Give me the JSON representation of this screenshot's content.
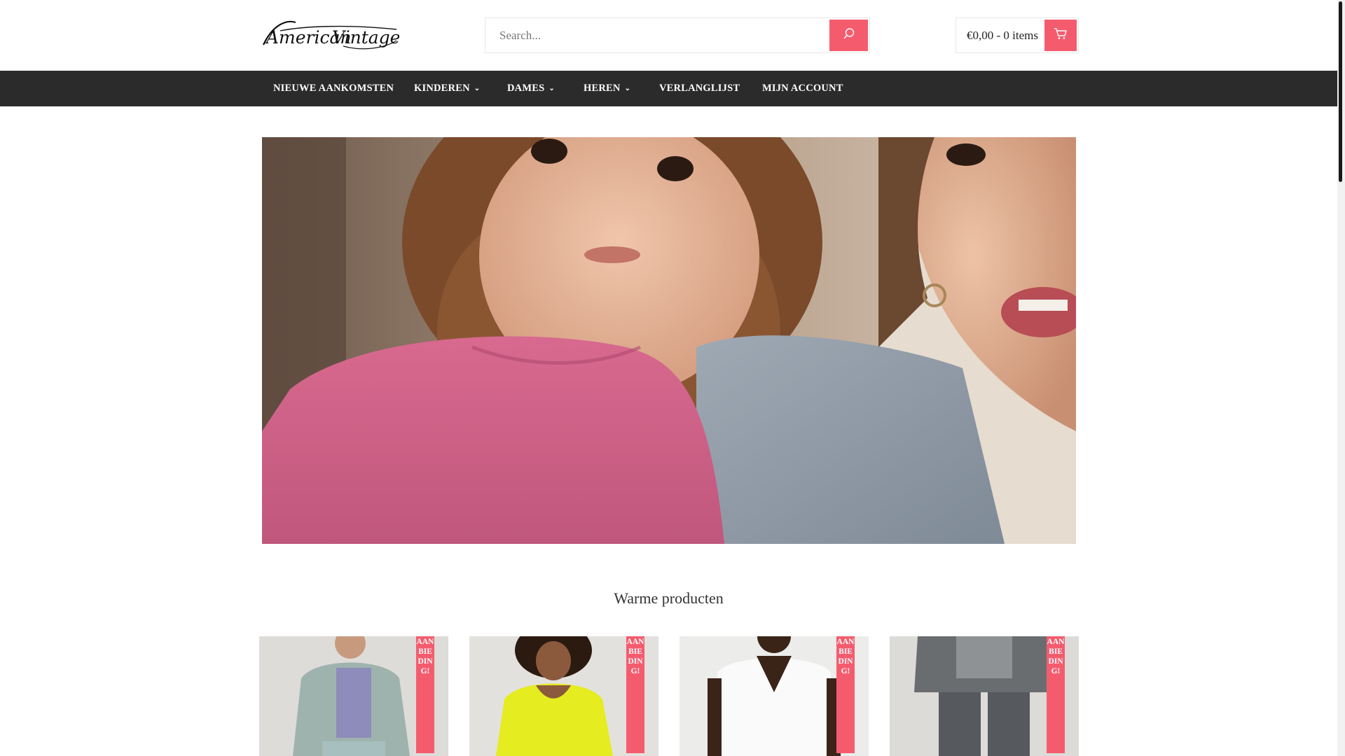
{
  "header": {
    "logo_text": "American Vintage",
    "search": {
      "placeholder": "Search...",
      "icon": "search-icon"
    },
    "cart": {
      "summary": "€0,00 - 0 items",
      "icon": "cart-icon"
    }
  },
  "nav": {
    "items": [
      {
        "label": "NIEUWE AANKOMSTEN",
        "has_dropdown": false
      },
      {
        "label": "KINDEREN",
        "has_dropdown": true
      },
      {
        "label": "DAMES",
        "has_dropdown": true
      },
      {
        "label": "HEREN",
        "has_dropdown": true
      },
      {
        "label": "VERLANGLIJST",
        "has_dropdown": false
      },
      {
        "label": "MIJN ACCOUNT",
        "has_dropdown": false
      }
    ]
  },
  "section": {
    "title": "Warme producten"
  },
  "products": [
    {
      "badge": "AANBIEDING!"
    },
    {
      "badge": "AANBIEDING!"
    },
    {
      "badge": "AANBIEDING!"
    },
    {
      "badge": "AANBIEDING!"
    }
  ],
  "colors": {
    "accent": "#f45c6e",
    "nav_bg": "#2b2b2b"
  }
}
